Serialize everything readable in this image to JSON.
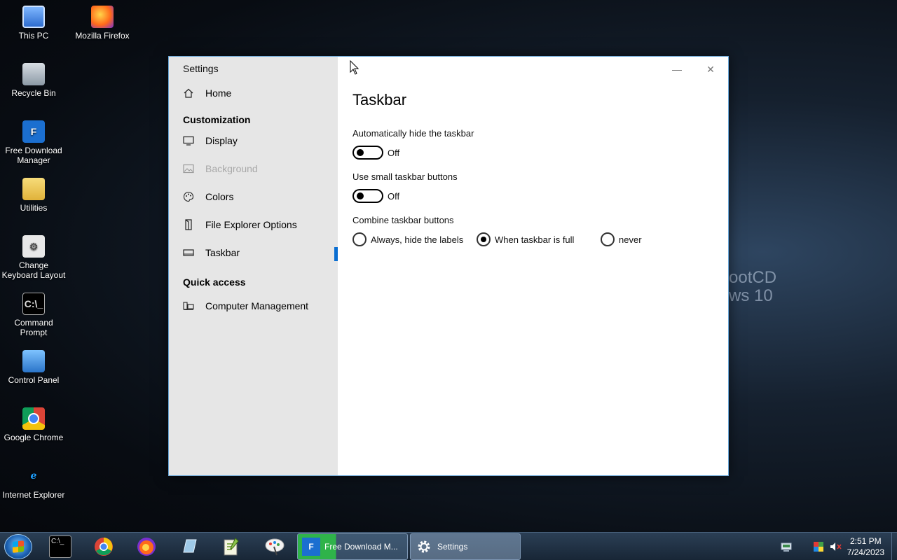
{
  "desktop": {
    "icons": [
      {
        "label": "This PC",
        "icon": "computer-icon"
      },
      {
        "label": "Mozilla Firefox",
        "icon": "firefox-icon"
      },
      {
        "label": "Recycle Bin",
        "icon": "recycle-bin-icon"
      },
      {
        "label": "Free Download Manager",
        "icon": "fdm-icon"
      },
      {
        "label": "Utilities",
        "icon": "folder-icon"
      },
      {
        "label": "Change Keyboard Layout",
        "icon": "keyboard-settings-icon"
      },
      {
        "label": "Command Prompt",
        "icon": "cmd-icon"
      },
      {
        "label": "Control Panel",
        "icon": "control-panel-icon"
      },
      {
        "label": "Google Chrome",
        "icon": "chrome-icon"
      },
      {
        "label": "Internet Explorer",
        "icon": "ie-icon"
      }
    ],
    "wallpaper_text": [
      "ootCD",
      "ws 10"
    ]
  },
  "window": {
    "title": "Settings",
    "minimize_label": "—",
    "close_label": "✕",
    "sidebar": {
      "home": "Home",
      "section_customization": "Customization",
      "items": [
        {
          "label": "Display",
          "icon": "monitor-icon",
          "state": "normal"
        },
        {
          "label": "Background",
          "icon": "picture-icon",
          "state": "disabled"
        },
        {
          "label": "Colors",
          "icon": "palette-icon",
          "state": "normal"
        },
        {
          "label": "File Explorer Options",
          "icon": "file-explorer-icon",
          "state": "normal"
        },
        {
          "label": "Taskbar",
          "icon": "taskbar-icon",
          "state": "selected"
        }
      ],
      "section_quick_access": "Quick access",
      "quick_items": [
        {
          "label": "Computer Management",
          "icon": "computer-management-icon"
        }
      ]
    },
    "content": {
      "title": "Taskbar",
      "auto_hide": {
        "label": "Automatically hide the taskbar",
        "state": "Off"
      },
      "small_buttons": {
        "label": "Use small taskbar buttons",
        "state": "Off"
      },
      "combine": {
        "label": "Combine taskbar buttons",
        "options": [
          "Always, hide the labels",
          "When taskbar is full",
          "never"
        ],
        "selected": "When taskbar is full"
      }
    }
  },
  "taskbar": {
    "pinned": [
      "cmd-icon",
      "chrome-icon",
      "firefox-icon",
      "notepad-icon",
      "notepadpp-icon",
      "paint-icon"
    ],
    "apps": [
      {
        "label": "Free Download M...",
        "icon": "fdm-icon"
      },
      {
        "label": "Settings",
        "icon": "gear-icon"
      }
    ],
    "time": "2:51 PM",
    "date": "7/24/2023"
  },
  "colors": {
    "accent": "#0a6ed1",
    "sidebar_bg": "#e6e6e6"
  }
}
